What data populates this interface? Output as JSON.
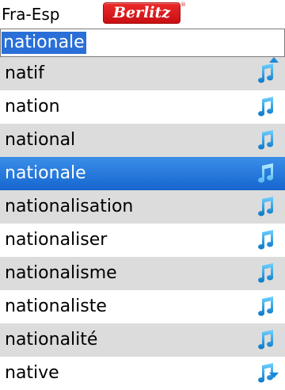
{
  "header": {
    "language_pair": "Fra-Esp",
    "logo_text": "Berlitz",
    "logo_mark": "®"
  },
  "search": {
    "value": "nationale"
  },
  "colors": {
    "accent": "#2a6fd8",
    "note_icon": "#1a8ad8",
    "row_alt": "#dcdcdc",
    "brand": "#d41a1e"
  },
  "list": {
    "items": [
      {
        "label": "natif",
        "icon": "music-note-icon"
      },
      {
        "label": "nation",
        "icon": "music-note-icon"
      },
      {
        "label": "national",
        "icon": "music-note-icon"
      },
      {
        "label": "nationale",
        "icon": "music-note-icon",
        "selected": true
      },
      {
        "label": "nationalisation",
        "icon": "music-note-icon"
      },
      {
        "label": "nationaliser",
        "icon": "music-note-icon"
      },
      {
        "label": "nationalisme",
        "icon": "music-note-icon"
      },
      {
        "label": "nationaliste",
        "icon": "music-note-icon"
      },
      {
        "label": "nationalité",
        "icon": "music-note-icon"
      },
      {
        "label": "native",
        "icon": "music-note-icon"
      }
    ]
  }
}
